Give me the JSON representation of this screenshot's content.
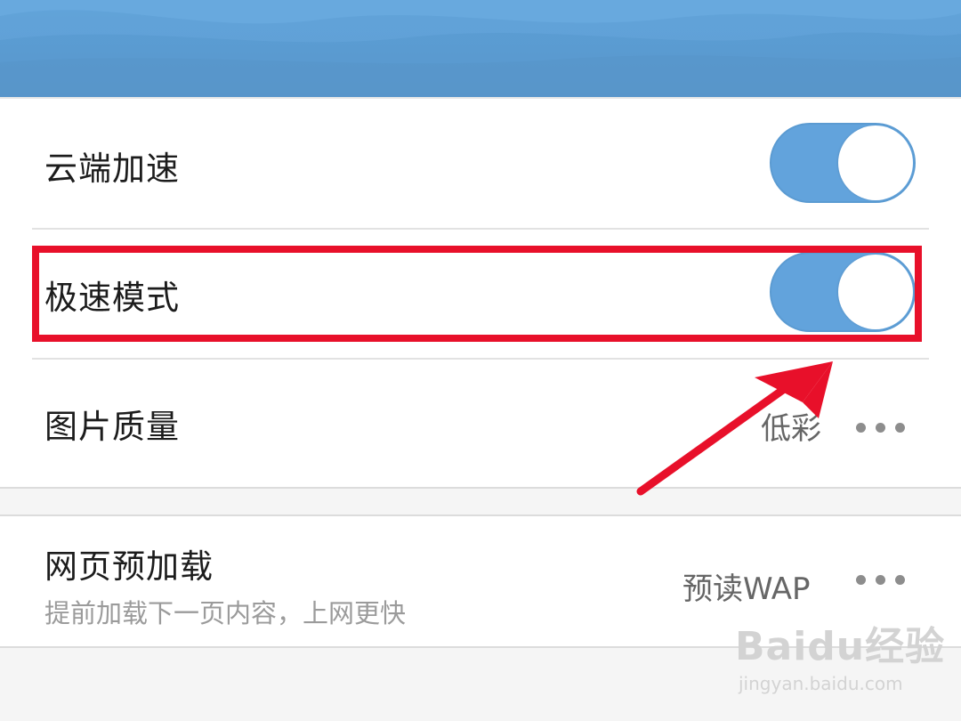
{
  "settings": {
    "group1": [
      {
        "label": "云端加速",
        "toggle_on": true
      },
      {
        "label": "极速模式",
        "toggle_on": true
      },
      {
        "label": "图片质量",
        "value": "低彩"
      }
    ],
    "group2": [
      {
        "label": "网页预加载",
        "sublabel": "提前加载下一页内容，上网更快",
        "value": "预读WAP"
      }
    ]
  },
  "annotation": {
    "highlight_color": "#e8102a",
    "arrow_color": "#e8102a"
  },
  "colors": {
    "header_blue": "#5b9fd6",
    "toggle_blue": "#62a3dc"
  },
  "watermark": {
    "brand": "Baidu经验",
    "url": "jingyan.baidu.com"
  }
}
